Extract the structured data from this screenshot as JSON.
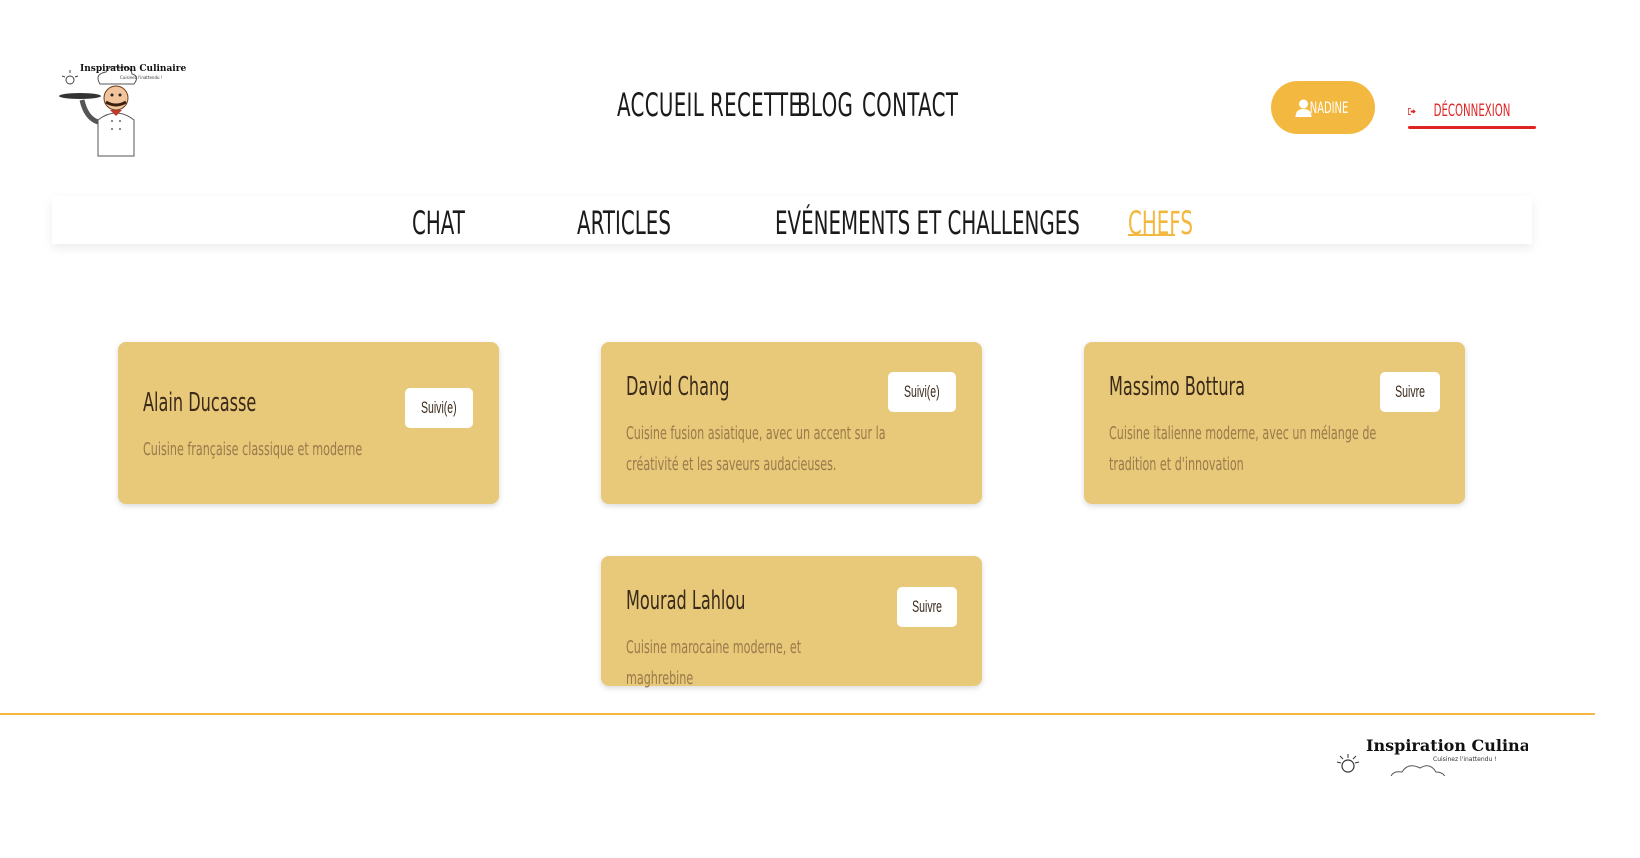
{
  "brand": {
    "name": "Inspiration Culinaire",
    "tagline": "Cuisinez l'inattendu !"
  },
  "main_nav": [
    "ACCUEIL",
    "RECETTE",
    "BLOG",
    "CONTACT"
  ],
  "user": {
    "name": "NADINE"
  },
  "logout": {
    "label": "DÉCONNEXION"
  },
  "tabs": [
    {
      "label": "CHAT",
      "active": false
    },
    {
      "label": "ARTICLES",
      "active": false
    },
    {
      "label": "EVÉNEMENTS ET CHALLENGES",
      "active": false
    },
    {
      "label": "CHEFS",
      "active": true
    }
  ],
  "chefs": [
    {
      "name": "Alain Ducasse",
      "description": "Cuisine française classique et moderne",
      "follow_label": "Suivi(e)"
    },
    {
      "name": "David Chang",
      "description": "Cuisine fusion asiatique, avec un accent sur la créativité et les saveurs audacieuses.",
      "follow_label": "Suivi(e)"
    },
    {
      "name": "Massimo Bottura",
      "description": "Cuisine italienne moderne, avec un mélange de tradition et d'innovation",
      "follow_label": "Suivre"
    },
    {
      "name": "Mourad Lahlou",
      "description": "Cuisine marocaine moderne, et maghrebine",
      "follow_label": "Suivre"
    }
  ],
  "colors": {
    "accent": "#f3b83f",
    "card": "#e8c97a",
    "logout": "#e02424"
  }
}
